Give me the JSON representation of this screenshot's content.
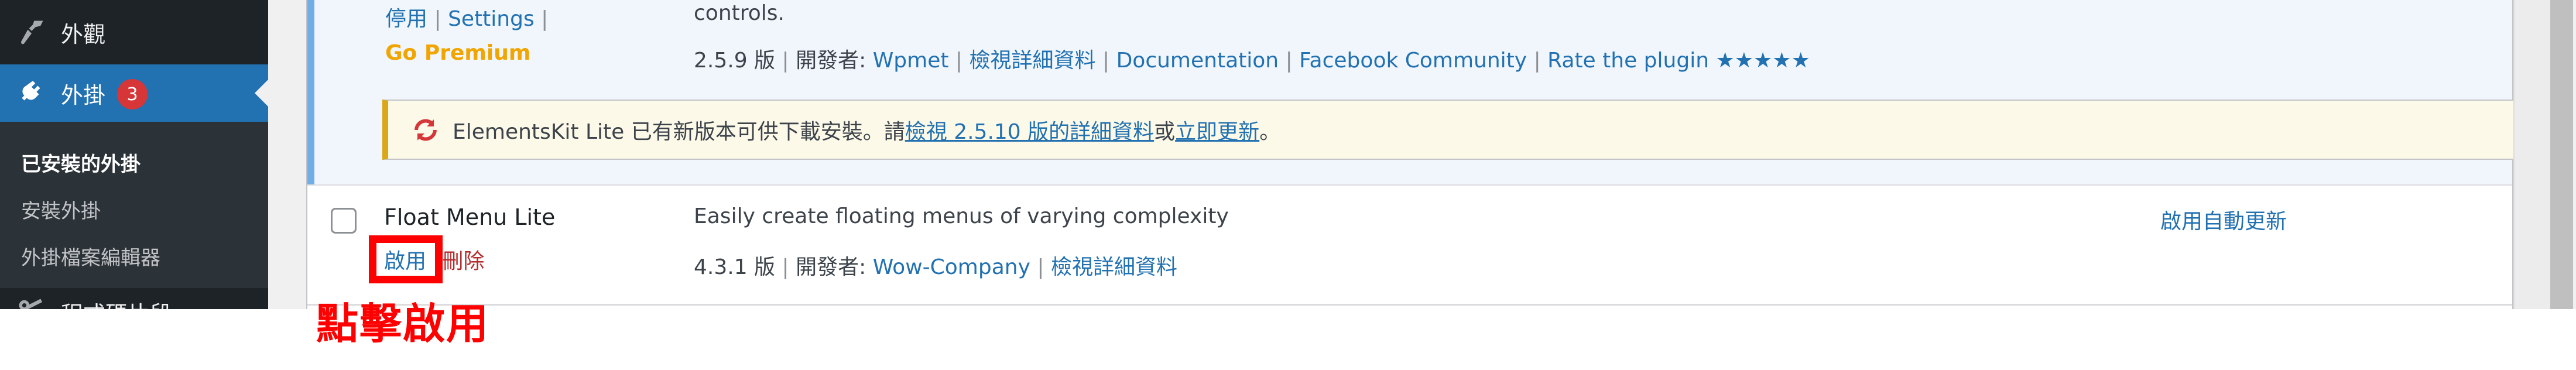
{
  "sidebar": {
    "items": [
      {
        "label": "外觀",
        "icon": "paintbrush-icon"
      },
      {
        "label": "外掛",
        "icon": "plugin-icon",
        "badge": "3",
        "active": true
      },
      {
        "label": "程式碼片段",
        "icon": "scissors-icon"
      }
    ],
    "submenu": [
      {
        "label": "已安裝的外掛",
        "current": true
      },
      {
        "label": "安裝外掛"
      },
      {
        "label": "外掛檔案編輯器"
      }
    ]
  },
  "plugins": [
    {
      "actions": {
        "deactivate": "停用",
        "settings": "Settings",
        "go_premium": "Go Premium"
      },
      "description": "controls.",
      "version": "2.5.9 版",
      "author_prefix": "開發者:",
      "author": "Wpmet",
      "view_details": "檢視詳細資料",
      "extra_links": [
        "Documentation",
        "Facebook Community",
        "Rate the plugin"
      ],
      "stars": "★★★★★",
      "update_notice": {
        "text": "ElementsKit Lite 已有新版本可供下載安裝。請",
        "details_link": "檢視 2.5.10 版的詳細資料",
        "or": "或",
        "update_link": "立即更新",
        "end": "。"
      }
    },
    {
      "name": "Float Menu Lite",
      "actions": {
        "activate": "啟用",
        "delete": "刪除"
      },
      "description": "Easily create floating menus of varying complexity",
      "version": "4.3.1 版",
      "author_prefix": "開發者:",
      "author": "Wow-Company",
      "view_details": "檢視詳細資料",
      "auto_update": "啟用自動更新"
    }
  ],
  "separator": "|",
  "annotation": {
    "label": "點擊啟用",
    "color": "#ff0000"
  },
  "colors": {
    "accent": "#2271b1",
    "sidebar_bg": "#1d2327",
    "submenu_bg": "#2c3338",
    "badge": "#d63638",
    "notice_border": "#dba617",
    "premium": "#f0a500"
  }
}
